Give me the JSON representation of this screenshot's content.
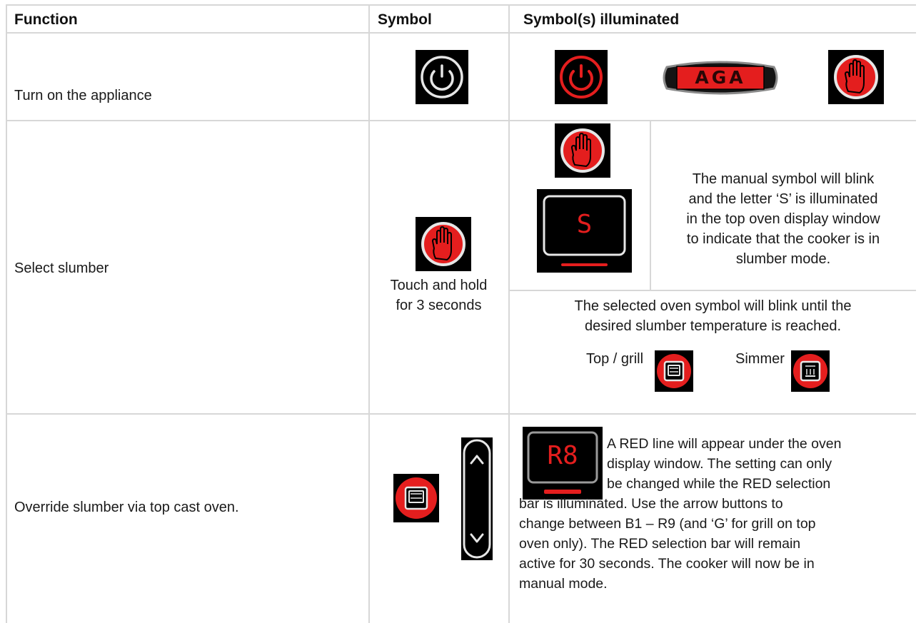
{
  "header": {
    "function": "Function",
    "symbol": "Symbol",
    "illuminated": "Symbol(s) illuminated"
  },
  "rows": [
    {
      "function": "Turn on the appliance",
      "badge_text": "AGA"
    },
    {
      "function": "Select slumber",
      "symbol_caption_1": "Touch and hold",
      "symbol_caption_2": "for 3 seconds",
      "desc_lines": [
        "The manual symbol will blink",
        "and the letter ‘S’ is illuminated",
        "in the top oven display window",
        "to indicate that the cooker is in",
        "slumber mode."
      ],
      "display_char": "S",
      "blink_lines": [
        "The selected oven symbol will blink until the",
        "desired slumber temperature is reached."
      ],
      "top_grill_label": "Top / grill",
      "simmer_label": "Simmer"
    },
    {
      "function": "Override slumber via top cast oven.",
      "display_text": "R8",
      "desc_lines": [
        "A RED line will appear under the oven",
        "display window. The setting can only",
        "be changed while the RED selection",
        "bar is illuminated. Use the arrow buttons to",
        "change between B1 – R9 (and ‘G’ for grill on top",
        "oven only). The RED selection bar will remain",
        "active for 30 seconds. The cooker will now be in",
        "manual mode."
      ]
    }
  ],
  "colors": {
    "icon_red": "#e41e1e",
    "icon_bg": "#000000",
    "ring_white": "#e6e6e6",
    "rule": "#d7d7d7"
  },
  "icons": [
    "power-icon",
    "power-lit-icon",
    "aga-badge-icon",
    "manual-hand-icon",
    "slumber-display-icon",
    "top-grill-oven-icon",
    "simmer-oven-icon",
    "arrow-up-down-icon",
    "r8-display-icon"
  ]
}
